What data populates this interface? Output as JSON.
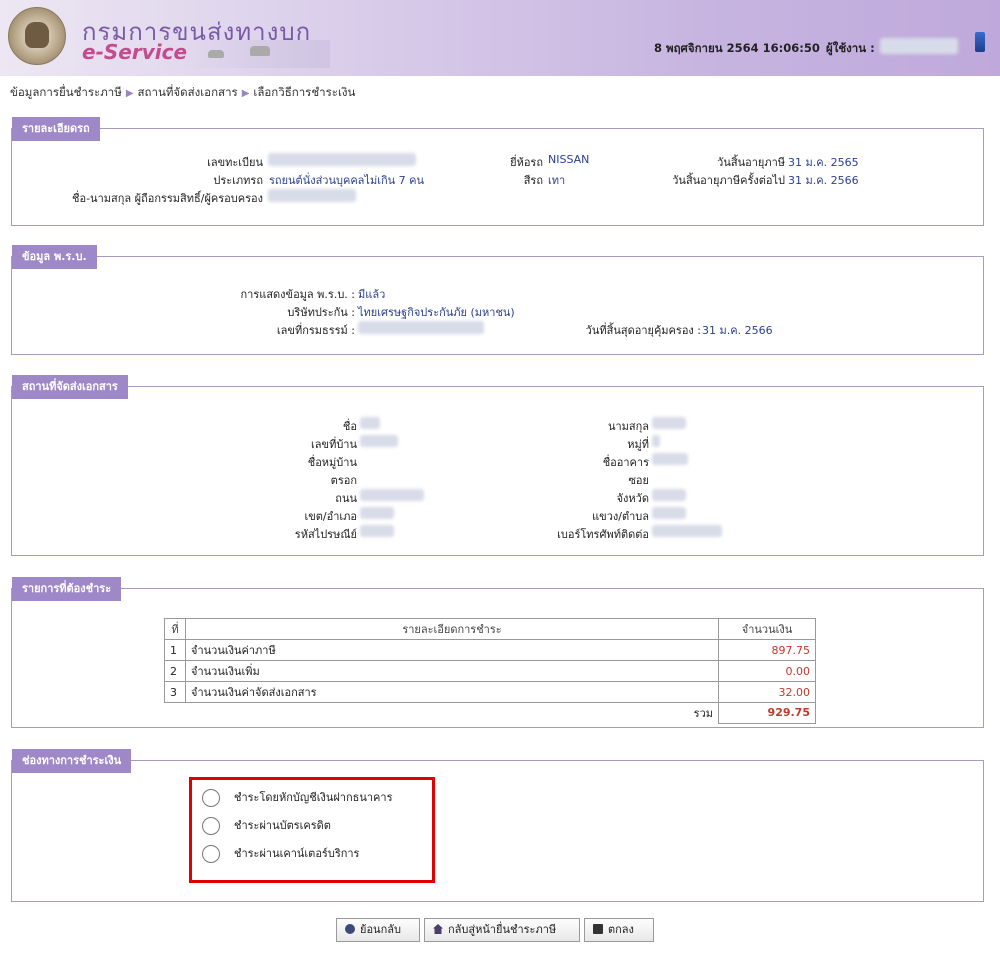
{
  "header": {
    "brand_th": "กรมการขนส่งทางบก",
    "brand_en": "e-Service",
    "datetime": "8 พฤศจิกายน 2564 16:06:50",
    "user_label": "ผู้ใช้งาน :"
  },
  "breadcrumb": [
    "ข้อมูลการยื่นชำระภาษี",
    "สถานที่จัดส่งเอกสาร",
    "เลือกวิธีการชำระเงิน"
  ],
  "vehicle": {
    "title": "รายละเอียดรถ",
    "plate_label": "เลขทะเบียน",
    "type_label": "ประเภทรถ",
    "type_value": "รถยนต์นั่งส่วนบุคคลไม่เกิน 7 คน",
    "owner_label": "ชื่อ-นามสกุล ผู้ถือกรรมสิทธิ์/ผู้ครอบครอง",
    "brand_label": "ยี่ห้อรถ",
    "brand_value": "NISSAN",
    "color_label": "สีรถ",
    "color_value": "เทา",
    "expire_label": "วันสิ้นอายุภาษี",
    "expire_value": "31 ม.ค. 2565",
    "next_expire_label": "วันสิ้นอายุภาษีครั้งต่อไป",
    "next_expire_value": "31 ม.ค. 2566"
  },
  "insurance": {
    "title": "ข้อมูล พ.ร.บ.",
    "show_label": "การแสดงข้อมูล พ.ร.บ. :",
    "show_value": "มีแล้ว",
    "company_label": "บริษัทประกัน :",
    "company_value": "ไทยเศรษฐกิจประกันภัย (มหาชน)",
    "policy_label": "เลขที่กรมธรรม์ :",
    "end_label": "วันที่สิ้นสุดอายุคุ้มครอง :",
    "end_value": "31 ม.ค. 2566"
  },
  "delivery": {
    "title": "สถานที่จัดส่งเอกสาร",
    "left_labels": [
      "ชื่อ",
      "เลขที่บ้าน",
      "ชื่อหมู่บ้าน",
      "ตรอก",
      "ถนน",
      "เขต/อำเภอ",
      "รหัสไปรษณีย์"
    ],
    "right_labels": [
      "นามสกุล",
      "หมู่ที่",
      "ชื่ออาคาร",
      "ซอย",
      "จังหวัด",
      "แขวง/ตำบล",
      "เบอร์โทรศัพท์ติดต่อ"
    ]
  },
  "payment_items": {
    "title": "รายการที่ต้องชำระ",
    "headers": [
      "ที่",
      "รายละเอียดการชำระ",
      "จำนวนเงิน"
    ],
    "rows": [
      {
        "no": "1",
        "desc": "จำนวนเงินค่าภาษี",
        "amount": "897.75"
      },
      {
        "no": "2",
        "desc": "จำนวนเงินเพิ่ม",
        "amount": "0.00"
      },
      {
        "no": "3",
        "desc": "จำนวนเงินค่าจัดส่งเอกสาร",
        "amount": "32.00"
      }
    ],
    "total_label": "รวม",
    "total": "929.75"
  },
  "payment_channel": {
    "title": "ช่องทางการชำระเงิน",
    "options": [
      "ชำระโดยหักบัญชีเงินฝากธนาคาร",
      "ชำระผ่านบัตรเครดิต",
      "ชำระผ่านเคาน์เตอร์บริการ"
    ]
  },
  "buttons": {
    "back": "ย้อนกลับ",
    "home": "กลับสู่หน้ายื่นชำระภาษี",
    "ok": "ตกลง"
  },
  "colors": {
    "header_purple": "#bfa9dc",
    "panel_title": "#9f88c8",
    "value_blue": "#2a3f8f",
    "amount_red": "#c0392b",
    "highlight": "#e00000"
  }
}
